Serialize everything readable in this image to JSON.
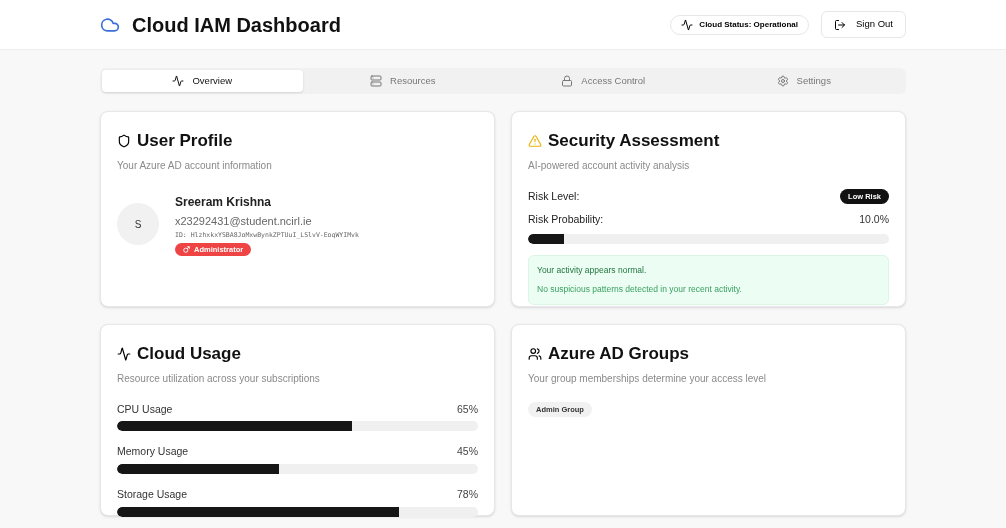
{
  "header": {
    "title": "Cloud IAM Dashboard",
    "status": "Cloud Status: Operational",
    "sign_out": "Sign Out"
  },
  "tabs": [
    {
      "label": "Overview",
      "selected": true
    },
    {
      "label": "Resources",
      "selected": false
    },
    {
      "label": "Access Control",
      "selected": false
    },
    {
      "label": "Settings",
      "selected": false
    }
  ],
  "user_profile": {
    "title": "User Profile",
    "subtitle": "Your Azure AD account information",
    "avatar": "S",
    "name": "Sreeram Krishna",
    "email": "x23292431@student.ncirl.ie",
    "id": "ID: HlzhxkxYSBA8JoMxwBynkZPTUuI_LSlvV-EoqWYIMvk",
    "role": "Administrator"
  },
  "security": {
    "title": "Security Assessment",
    "subtitle": "AI-powered account activity analysis",
    "risk_label": "Risk Level:",
    "risk_badge": "Low Risk",
    "prob_label": "Risk Probability:",
    "prob_value": "10.0%",
    "level": 0.1,
    "alert_title": "Your activity appears normal.",
    "alert_text": "No suspicious patterns detected in your recent activity."
  },
  "cloud_usage": {
    "title": "Cloud Usage",
    "subtitle": "Resource utilization across your subscriptions",
    "meters": [
      {
        "name": "CPU Usage",
        "reading": "65%",
        "level": 0.65
      },
      {
        "name": "Memory Usage",
        "reading": "45%",
        "level": 0.45
      },
      {
        "name": "Storage Usage",
        "reading": "78%",
        "level": 0.78
      }
    ]
  },
  "groups": {
    "title": "Azure AD Groups",
    "subtitle": "Your group memberships determine your access level",
    "items": [
      "Admin Group"
    ]
  }
}
